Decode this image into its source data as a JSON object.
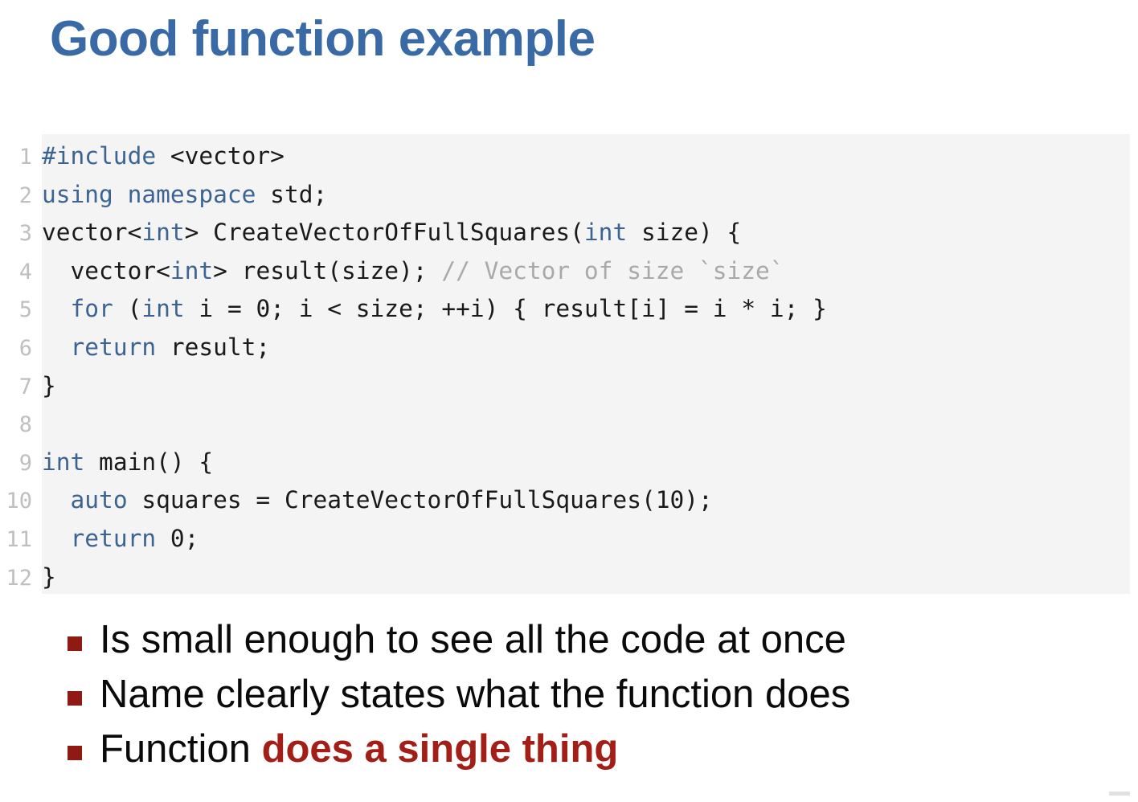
{
  "slide": {
    "title": "Good function example",
    "title_color": "#3A6AA5",
    "background_color": "#FFFFFF"
  },
  "code_block": {
    "background_color": "#F4F4F5",
    "gutter_color": "#FFFFFF",
    "line_number_color": "#BFBFBF",
    "keyword_color": "#3C6493",
    "comment_color": "#A9A9A9",
    "text_color": "#1A1A1A",
    "language": "cpp",
    "line_numbers": [
      "1",
      "2",
      "3",
      "4",
      "5",
      "6",
      "7",
      "8",
      "9",
      "10",
      "11",
      "12"
    ],
    "lines": [
      {
        "number": "1",
        "text": "#include <vector>"
      },
      {
        "number": "2",
        "text": "using namespace std;"
      },
      {
        "number": "3",
        "text": "vector<int> CreateVectorOfFullSquares(int size) {"
      },
      {
        "number": "4",
        "text": "  vector<int> result(size); // Vector of size `size`"
      },
      {
        "number": "5",
        "text": "  for (int i = 0; i < size; ++i) { result[i] = i * i; }"
      },
      {
        "number": "6",
        "text": "  return result;"
      },
      {
        "number": "7",
        "text": "}"
      },
      {
        "number": "8",
        "text": ""
      },
      {
        "number": "9",
        "text": "int main() {"
      },
      {
        "number": "10",
        "text": "  auto squares = CreateVectorOfFullSquares(10);"
      },
      {
        "number": "11",
        "text": "  return 0;"
      },
      {
        "number": "12",
        "text": "}"
      }
    ],
    "tokens": [
      {
        "number": "1",
        "parts": [
          {
            "t": "#include",
            "c": "kw"
          },
          {
            "t": " <vector>",
            "c": "plain"
          }
        ]
      },
      {
        "number": "2",
        "parts": [
          {
            "t": "using namespace",
            "c": "kw"
          },
          {
            "t": " std;",
            "c": "plain"
          }
        ]
      },
      {
        "number": "3",
        "parts": [
          {
            "t": "vector<",
            "c": "plain"
          },
          {
            "t": "int",
            "c": "kw"
          },
          {
            "t": "> CreateVectorOfFullSquares(",
            "c": "plain"
          },
          {
            "t": "int",
            "c": "kw"
          },
          {
            "t": " size) {",
            "c": "plain"
          }
        ]
      },
      {
        "number": "4",
        "parts": [
          {
            "t": "  vector<",
            "c": "plain"
          },
          {
            "t": "int",
            "c": "kw"
          },
          {
            "t": "> result(size); ",
            "c": "plain"
          },
          {
            "t": "// Vector of size `size`",
            "c": "cmt"
          }
        ]
      },
      {
        "number": "5",
        "parts": [
          {
            "t": "  ",
            "c": "plain"
          },
          {
            "t": "for",
            "c": "kw"
          },
          {
            "t": " (",
            "c": "plain"
          },
          {
            "t": "int",
            "c": "kw"
          },
          {
            "t": " i = 0; i < size; ++i) { result[i] = i * i; }",
            "c": "plain"
          }
        ]
      },
      {
        "number": "6",
        "parts": [
          {
            "t": "  ",
            "c": "plain"
          },
          {
            "t": "return",
            "c": "kw"
          },
          {
            "t": " result;",
            "c": "plain"
          }
        ]
      },
      {
        "number": "7",
        "parts": [
          {
            "t": "}",
            "c": "plain"
          }
        ]
      },
      {
        "number": "8",
        "parts": [
          {
            "t": "",
            "c": "plain"
          }
        ]
      },
      {
        "number": "9",
        "parts": [
          {
            "t": "int",
            "c": "kw"
          },
          {
            "t": " main() {",
            "c": "plain"
          }
        ]
      },
      {
        "number": "10",
        "parts": [
          {
            "t": "  ",
            "c": "plain"
          },
          {
            "t": "auto",
            "c": "kw"
          },
          {
            "t": " squares = CreateVectorOfFullSquares(10);",
            "c": "plain"
          }
        ]
      },
      {
        "number": "11",
        "parts": [
          {
            "t": "  ",
            "c": "plain"
          },
          {
            "t": "return",
            "c": "kw"
          },
          {
            "t": " 0;",
            "c": "plain"
          }
        ]
      },
      {
        "number": "12",
        "parts": [
          {
            "t": "}",
            "c": "plain"
          }
        ]
      }
    ]
  },
  "bullets": {
    "marker_color": "#8E1A13",
    "emphasis_color": "#A31E16",
    "items": [
      {
        "parts": [
          {
            "t": "Is small enough to see all the code at once",
            "emphasis": false
          }
        ]
      },
      {
        "parts": [
          {
            "t": "Name clearly states what the function does",
            "emphasis": false
          }
        ]
      },
      {
        "parts": [
          {
            "t": "Function ",
            "emphasis": false
          },
          {
            "t": "does a single thing",
            "emphasis": true
          }
        ]
      }
    ]
  }
}
